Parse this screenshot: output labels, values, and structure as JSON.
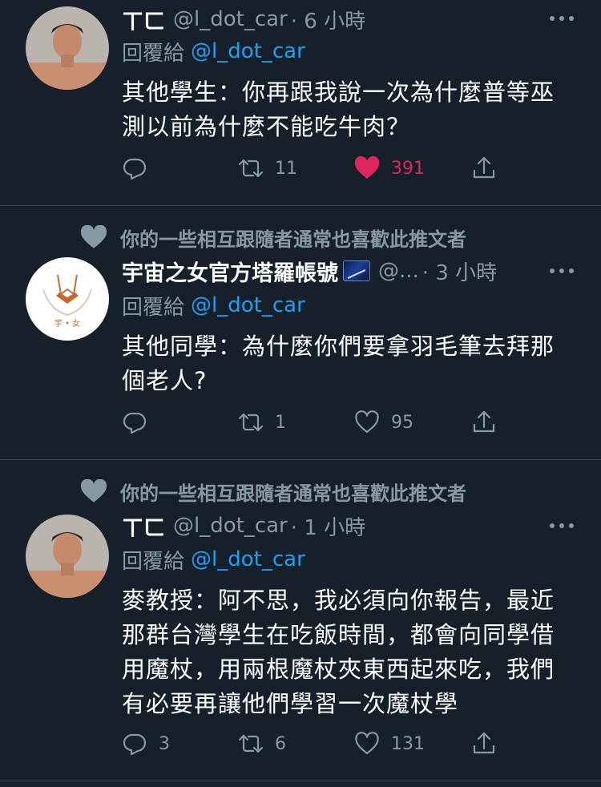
{
  "tweets": [
    {
      "name": "ㄒㄈ",
      "handle": "@l_dot_car",
      "time": "· 6 小時",
      "reply_label": "回覆給",
      "reply_to": "@l_dot_car",
      "text_lines": [
        "其他學生：你再跟我說一次為什麼普等巫",
        "測以前為什麼不能吃牛肉？"
      ],
      "retweets": "11",
      "likes": "391",
      "liked": true
    },
    {
      "social_context": "你的一些相互跟隨者通常也喜歡此推文者",
      "name": "宇宙之女官方塔羅帳號",
      "handle": "@...",
      "time": "· 3 小時",
      "reply_label": "回覆給",
      "reply_to": "@l_dot_car",
      "text_lines": [
        "其他同學：為什麼你們要拿羽毛筆去拜那",
        "個老人?"
      ],
      "retweets": "1",
      "likes": "95",
      "liked": false
    },
    {
      "social_context": "你的一些相互跟隨者通常也喜歡此推文者",
      "name": "ㄒㄈ",
      "handle": "@l_dot_car",
      "time": "· 1 小時",
      "reply_label": "回覆給",
      "reply_to": "@l_dot_car",
      "text_lines": [
        "麥教授：阿不思，我必須向你報告，最近",
        "那群台灣學生在吃飯時間，都會向同學借",
        "用魔杖，用兩根魔杖夾東西起來吃，我們",
        "有必要再讓他們學習一次魔杖學"
      ],
      "replies": "3",
      "retweets": "6",
      "likes": "131",
      "liked": false
    }
  ],
  "icons": {
    "reply": "reply-icon",
    "retweet": "retweet-icon",
    "like": "heart-icon",
    "share": "share-icon",
    "more": "more-icon",
    "social_heart": "heart-icon"
  },
  "colors": {
    "background": "#15202b",
    "secondary_text": "#8899a6",
    "link": "#1da1f2",
    "liked": "#e0245e",
    "divider": "#38444d"
  }
}
